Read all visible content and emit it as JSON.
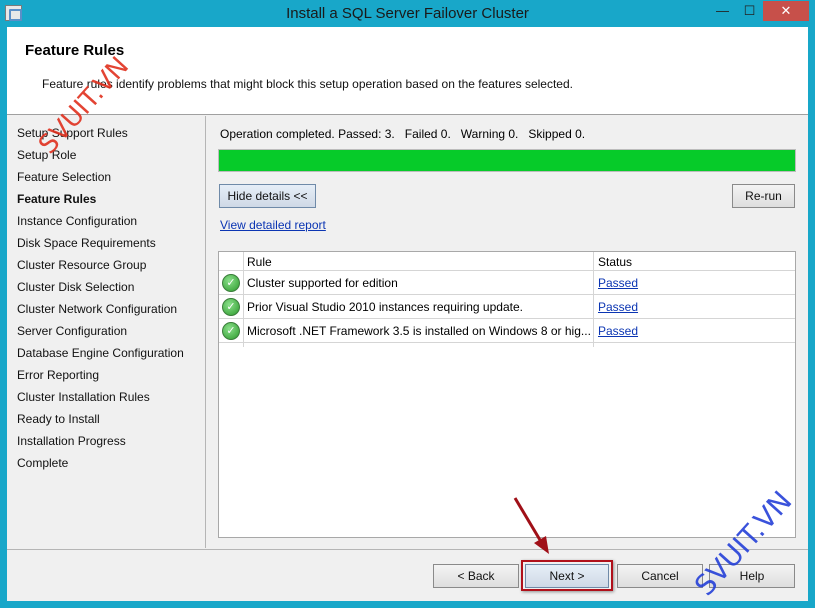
{
  "window": {
    "title": "Install a SQL Server Failover Cluster",
    "controls": {
      "minimize": "—",
      "maximize": "☐",
      "close": "✕"
    }
  },
  "header": {
    "title": "Feature Rules",
    "description": "Feature rules identify problems that might block this setup operation based on the features selected."
  },
  "nav": {
    "items": [
      {
        "label": "Setup Support Rules"
      },
      {
        "label": "Setup Role"
      },
      {
        "label": "Feature Selection"
      },
      {
        "label": "Feature Rules",
        "active": true
      },
      {
        "label": "Instance Configuration"
      },
      {
        "label": "Disk Space Requirements"
      },
      {
        "label": "Cluster Resource Group"
      },
      {
        "label": "Cluster Disk Selection"
      },
      {
        "label": "Cluster Network Configuration"
      },
      {
        "label": "Server Configuration"
      },
      {
        "label": "Database Engine Configuration"
      },
      {
        "label": "Error Reporting"
      },
      {
        "label": "Cluster Installation Rules"
      },
      {
        "label": "Ready to Install"
      },
      {
        "label": "Installation Progress"
      },
      {
        "label": "Complete"
      }
    ]
  },
  "main": {
    "status_text": "Operation completed. Passed: 3.   Failed 0.   Warning 0.   Skipped 0.",
    "progress": 1.0,
    "progress_color": "#06cb29",
    "hide_details_label": "Hide details <<",
    "rerun_label": "Re-run",
    "report_link": "View detailed report",
    "table": {
      "columns": [
        "Rule",
        "Status"
      ],
      "rows": [
        {
          "rule": "Cluster supported for edition",
          "status": "Passed",
          "icon": "check-circle-icon"
        },
        {
          "rule": "Prior Visual Studio 2010 instances requiring update.",
          "status": "Passed",
          "icon": "check-circle-icon"
        },
        {
          "rule": "Microsoft .NET Framework 3.5 is installed on Windows 8 or hig...",
          "status": "Passed",
          "icon": "check-circle-icon"
        }
      ]
    }
  },
  "footer": {
    "back_label": "< Back",
    "next_label": "Next >",
    "cancel_label": "Cancel",
    "help_label": "Help"
  },
  "watermarks": [
    "SVUIT.VN",
    "SVUIT.VN"
  ],
  "colors": {
    "titlebar": "#18a7c9",
    "close": "#c7504a",
    "highlight": "#b0101a"
  }
}
